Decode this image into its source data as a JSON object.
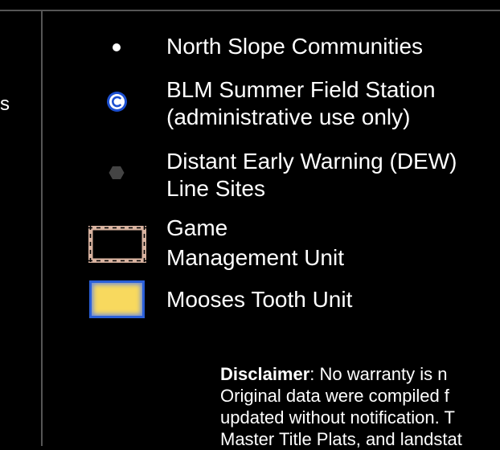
{
  "left_cut_text": "s",
  "legend": {
    "items": [
      {
        "symbol": "white-dot",
        "lines": [
          "North Slope Communities"
        ]
      },
      {
        "symbol": "circled-c",
        "lines": [
          "BLM Summer Field Station",
          "(administrative use only)"
        ]
      },
      {
        "symbol": "gray-hexagon",
        "lines": [
          "Distant Early Warning (DEW)",
          "Line Sites"
        ]
      },
      {
        "symbol": "dashed-rectangle",
        "lines": [
          "Game",
          "Management Unit"
        ]
      },
      {
        "symbol": "yellow-rectangle",
        "lines": [
          "Mooses Tooth Unit"
        ]
      }
    ]
  },
  "disclaimer": {
    "label": "Disclaimer",
    "lines": [
      ":  No warranty is n",
      "Original data were compiled f",
      "updated without notification. T",
      "Master Title Plats, and landstat"
    ]
  },
  "colors": {
    "background": "#000000",
    "frame": "#555555",
    "field_station_blue": "#1c4fd0",
    "dew_gray": "#444444",
    "gmu_border": "#d9b3a0",
    "mooses_fill": "#f8d95e",
    "mooses_border": "#2a5fd8"
  }
}
